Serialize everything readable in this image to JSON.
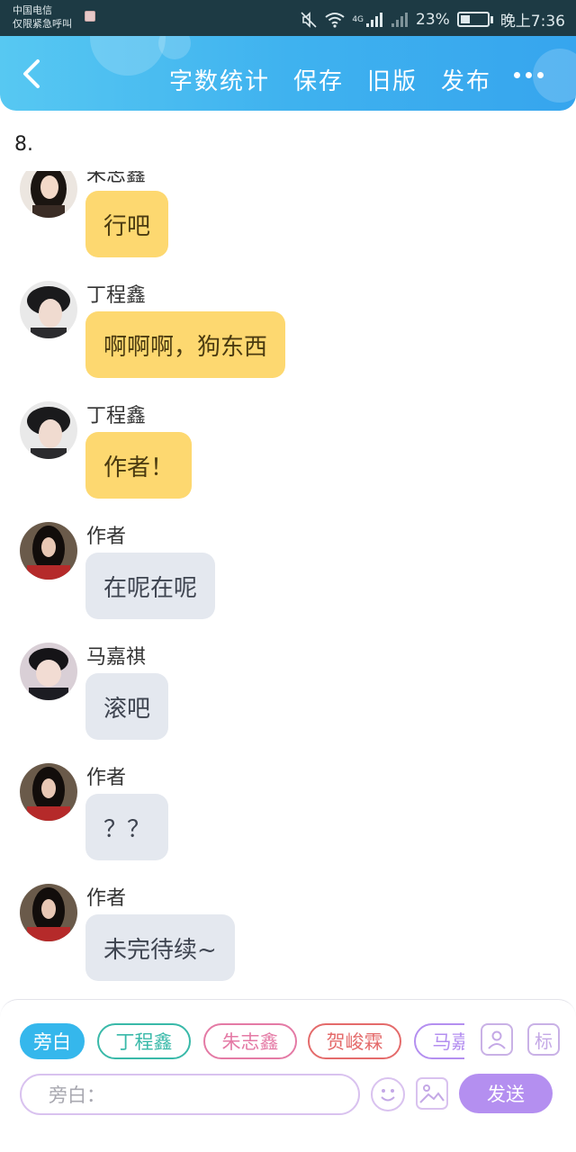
{
  "status_bar": {
    "carrier_line1": "中国电信",
    "carrier_line2": "仅限紧急呼叫",
    "network": "4G",
    "battery": "23%",
    "time": "晚上7:36"
  },
  "header": {
    "actions": [
      "字数统计",
      "保存",
      "旧版",
      "发布"
    ]
  },
  "chapter_number": "8.",
  "messages": [
    {
      "name": "朱志鑫",
      "text": "行吧",
      "color": "yellow"
    },
    {
      "name": "丁程鑫",
      "text": "啊啊啊，狗东西",
      "color": "yellow"
    },
    {
      "name": "丁程鑫",
      "text": "作者！",
      "color": "yellow"
    },
    {
      "name": "作者",
      "text": "在呢在呢",
      "color": "gray"
    },
    {
      "name": "马嘉祺",
      "text": "滚吧",
      "color": "gray"
    },
    {
      "name": "作者",
      "text": "？？",
      "color": "gray"
    },
    {
      "name": "作者",
      "text": "未完待续~",
      "color": "gray"
    }
  ],
  "composer": {
    "roles": [
      "旁白",
      "丁程鑫",
      "朱志鑫",
      "贺峻霖",
      "马嘉祺"
    ],
    "role_colors": [
      "#35b7ec",
      "#39b9a9",
      "#e47aa5",
      "#e46b6b",
      "#b48ff0"
    ],
    "label_icon_text": "标",
    "input_placeholder": "旁白：",
    "send_label": "发送"
  }
}
